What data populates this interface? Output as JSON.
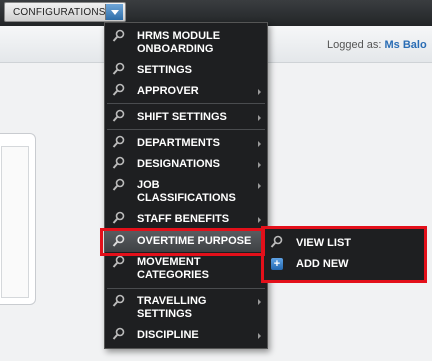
{
  "topbar": {
    "config_label": "CONFIGURATIONS"
  },
  "header": {
    "logged_prefix": "Logged as:",
    "user": "Ms Balo"
  },
  "menu": {
    "items": [
      {
        "label1": "HRMS MODULE",
        "label2": "ONBOARDING",
        "submenu": false
      },
      {
        "label1": "SETTINGS",
        "submenu": false
      },
      {
        "label1": "APPROVER",
        "submenu": true
      },
      {
        "label1": "SHIFT SETTINGS",
        "submenu": true
      },
      {
        "label1": "DEPARTMENTS",
        "submenu": true
      },
      {
        "label1": "DESIGNATIONS",
        "submenu": true
      },
      {
        "label1": "JOB",
        "label2": "CLASSIFICATIONS",
        "submenu": true
      },
      {
        "label1": "STAFF BENEFITS",
        "submenu": true
      },
      {
        "label1": "OVERTIME PURPOSE",
        "submenu": true,
        "highlighted": true
      },
      {
        "label1": "MOVEMENT",
        "label2": "CATEGORIES",
        "submenu": true
      },
      {
        "label1": "TRAVELLING",
        "label2": "SETTINGS",
        "submenu": true
      },
      {
        "label1": "DISCIPLINE",
        "submenu": true
      }
    ]
  },
  "submenu": {
    "items": [
      {
        "label": "VIEW LIST",
        "icon": "magnifier-icon"
      },
      {
        "label": "ADD NEW",
        "icon": "plus-icon"
      }
    ]
  },
  "colors": {
    "highlight_box": "#e3101a",
    "menu_bg": "#1e1f21",
    "accent": "#2a6db5"
  }
}
